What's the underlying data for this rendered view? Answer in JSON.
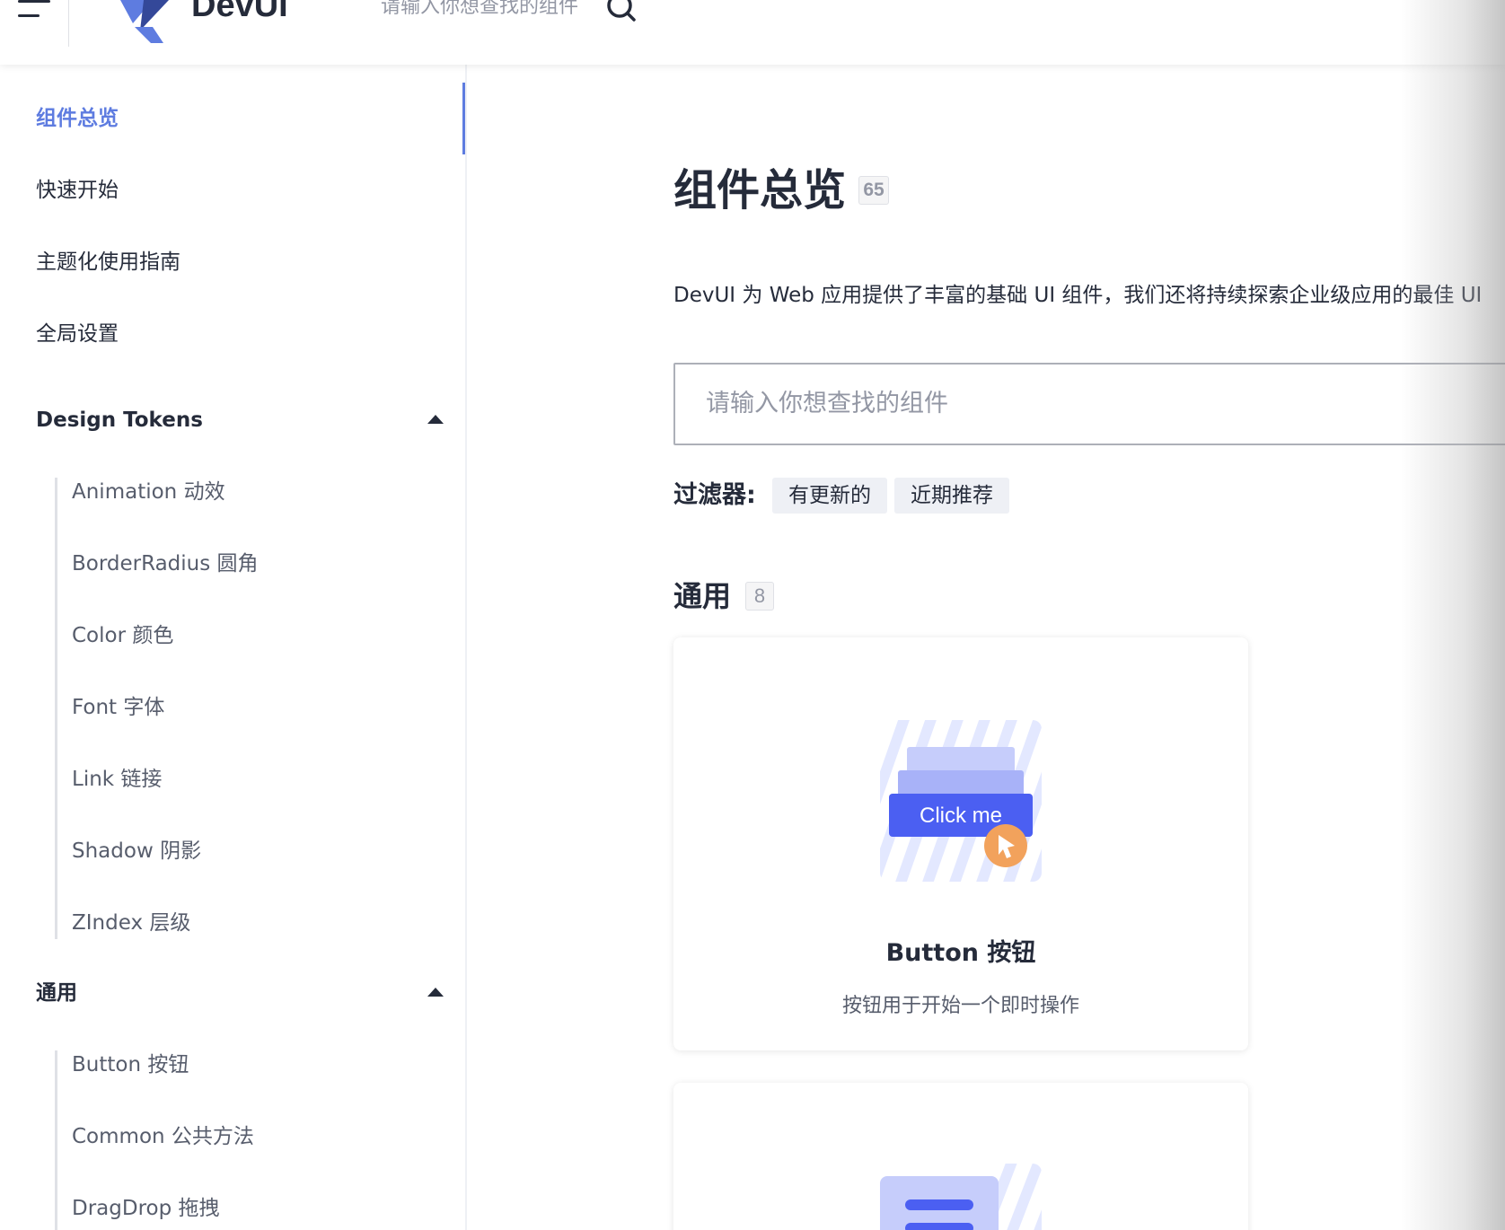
{
  "header": {
    "logo_text": "DevUI",
    "search_placeholder": "请输入你想查找的组件"
  },
  "sidebar": {
    "items": [
      {
        "label": "组件总览",
        "active": true
      },
      {
        "label": "快速开始"
      },
      {
        "label": "主题化使用指南"
      },
      {
        "label": "全局设置"
      }
    ],
    "groups": [
      {
        "title": "Design Tokens",
        "expanded": true,
        "items": [
          "Animation 动效",
          "BorderRadius 圆角",
          "Color 颜色",
          "Font 字体",
          "Link 链接",
          "Shadow 阴影",
          "ZIndex 层级"
        ]
      },
      {
        "title": "通用",
        "expanded": true,
        "items": [
          "Button 按钮",
          "Common 公共方法",
          "DragDrop 拖拽"
        ]
      }
    ]
  },
  "main": {
    "title": "组件总览",
    "total_count": "65",
    "description": "DevUI 为 Web 应用提供了丰富的基础 UI 组件，我们还将持续探索企业级应用的最佳 UI",
    "search_placeholder": "请输入你想查找的组件",
    "filter_label": "过滤器:",
    "filters": [
      "有更新的",
      "近期推荐"
    ],
    "section": {
      "title": "通用",
      "count": "8"
    },
    "cards": [
      {
        "title": "Button 按钮",
        "description": "按钮用于开始一个即时操作",
        "illustration_text": "Click me"
      }
    ]
  },
  "colors": {
    "brand": "#5e7ce0",
    "button": "#4b5ff2",
    "cursor": "#f2a25c"
  }
}
